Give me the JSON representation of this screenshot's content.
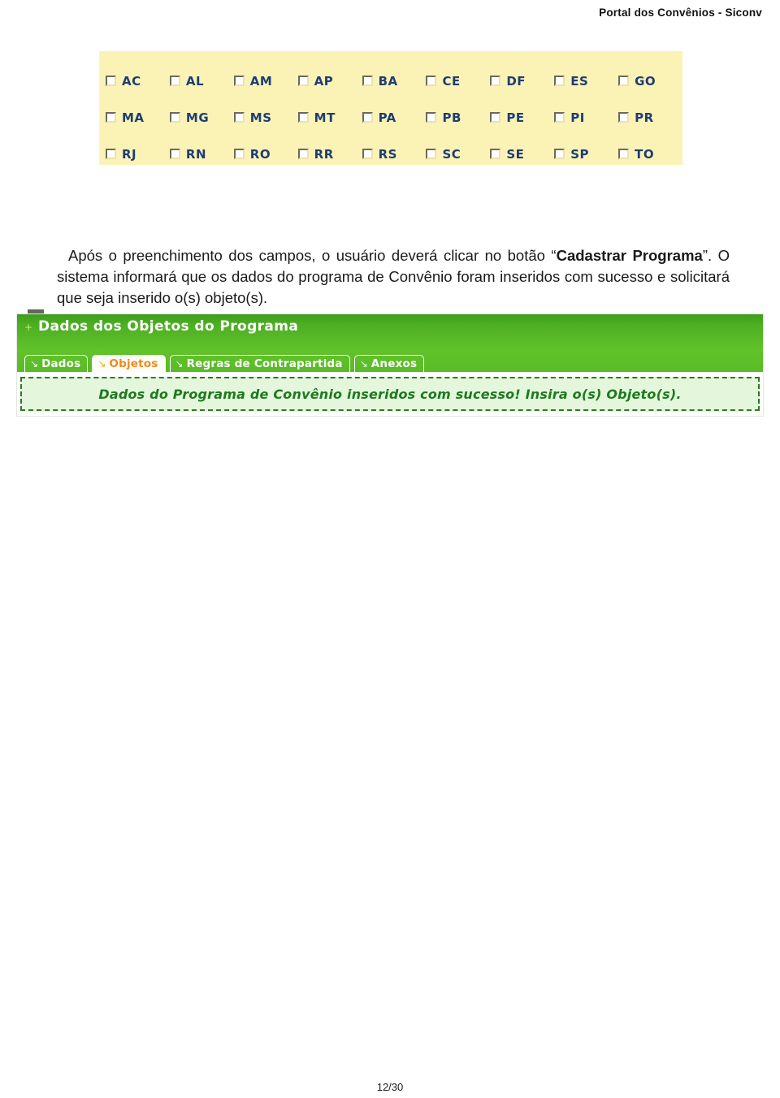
{
  "header": {
    "title": "Portal dos Convênios -  Siconv"
  },
  "states_panel": {
    "name": "state-selection-grid",
    "background_color": "#fbf3b6",
    "label_color": "#1f3d73",
    "rows": [
      [
        "AC",
        "AL",
        "AM",
        "AP",
        "BA",
        "CE",
        "DF",
        "ES",
        "GO"
      ],
      [
        "MA",
        "MG",
        "MS",
        "MT",
        "PA",
        "PB",
        "PE",
        "PI",
        "PR"
      ],
      [
        "RJ",
        "RN",
        "RO",
        "RR",
        "RS",
        "SC",
        "SE",
        "SP",
        "TO"
      ]
    ]
  },
  "paragraph": {
    "part1": "Após o preenchimento dos campos, o usuário deverá clicar no botão “",
    "bold1": "Cadastrar Programa",
    "part2": "”. O sistema informará que  os dados do programa de Convênio foram inseridos com sucesso e solicitará que seja inserido o(s) objeto(s)."
  },
  "screenshot": {
    "panel": {
      "title": "Dados dos Objetos do Programa",
      "expand_icon": "+",
      "accent_color": "#62c22b"
    },
    "tabs": [
      {
        "label": "Dados",
        "icon": "↘",
        "active": false
      },
      {
        "label": "Objetos",
        "icon": "↘",
        "active": true
      },
      {
        "label": "Regras de Contrapartida",
        "icon": "↘",
        "active": false
      },
      {
        "label": "Anexos",
        "icon": "↘",
        "active": false
      }
    ],
    "message": {
      "text": "Dados do Programa de Convênio inseridos com sucesso! Insira o(s) Objeto(s).",
      "text_color": "#1d7a1d",
      "background_color": "#e4f7dd",
      "border_color": "#2d7a1f"
    }
  },
  "footer": {
    "page": "12/30"
  }
}
